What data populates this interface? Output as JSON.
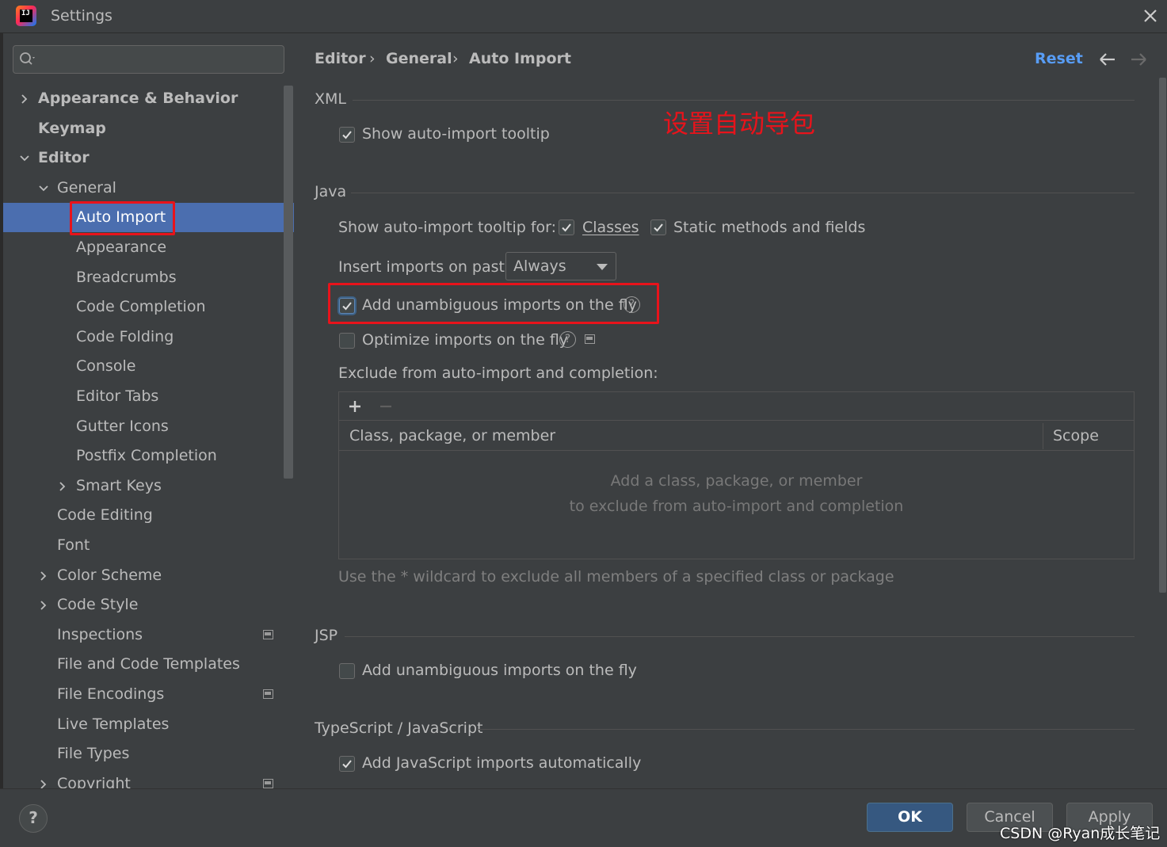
{
  "window": {
    "title": "Settings"
  },
  "sidebar": {
    "search_placeholder": "",
    "items": [
      {
        "label": "Appearance & Behavior",
        "bold": true,
        "chevron": "right"
      },
      {
        "label": "Keymap",
        "bold": true
      },
      {
        "label": "Editor",
        "bold": true,
        "chevron": "down"
      },
      {
        "label": "General",
        "chevron": "down"
      },
      {
        "label": "Auto Import",
        "selected": true
      },
      {
        "label": "Appearance"
      },
      {
        "label": "Breadcrumbs"
      },
      {
        "label": "Code Completion"
      },
      {
        "label": "Code Folding"
      },
      {
        "label": "Console"
      },
      {
        "label": "Editor Tabs"
      },
      {
        "label": "Gutter Icons"
      },
      {
        "label": "Postfix Completion"
      },
      {
        "label": "Smart Keys",
        "chevron": "right"
      },
      {
        "label": "Code Editing"
      },
      {
        "label": "Font"
      },
      {
        "label": "Color Scheme",
        "chevron": "right"
      },
      {
        "label": "Code Style",
        "chevron": "right"
      },
      {
        "label": "Inspections",
        "badge": true
      },
      {
        "label": "File and Code Templates"
      },
      {
        "label": "File Encodings",
        "badge": true
      },
      {
        "label": "Live Templates"
      },
      {
        "label": "File Types"
      },
      {
        "label": "Copyright",
        "chevron": "right",
        "badge": true
      }
    ]
  },
  "breadcrumb": {
    "part1": "Editor",
    "sep": "›",
    "part2": "General",
    "part3": "Auto Import"
  },
  "header": {
    "reset_label": "Reset"
  },
  "annotation": {
    "text": "设置自动导包"
  },
  "xml": {
    "title": "XML",
    "show_tooltip_label": "Show auto-import tooltip",
    "show_tooltip_checked": true
  },
  "java": {
    "title": "Java",
    "tooltip_for_label": "Show auto-import tooltip for:",
    "classes_label": "Classes",
    "classes_checked": true,
    "static_label": "Static methods and fields",
    "static_checked": true,
    "insert_on_paste_label": "Insert imports on paste:",
    "insert_on_paste_value": "Always",
    "add_unambiguous_label": "Add unambiguous imports on the fly",
    "add_unambiguous_checked": true,
    "optimize_label": "Optimize imports on the fly",
    "optimize_checked": false,
    "exclude_label": "Exclude from auto-import and completion:",
    "table": {
      "col1": "Class, package, or member",
      "col2": "Scope",
      "empty_line1": "Add a class, package, or member",
      "empty_line2": "to exclude from auto-import and completion"
    },
    "hint": "Use the * wildcard to exclude all members of a specified class or package"
  },
  "jsp": {
    "title": "JSP",
    "add_unambiguous_label": "Add unambiguous imports on the fly",
    "add_unambiguous_checked": false
  },
  "typescript": {
    "title": "TypeScript / JavaScript",
    "add_js_label": "Add JavaScript imports automatically",
    "add_js_checked": true
  },
  "buttons": {
    "help": "?",
    "ok": "OK",
    "cancel": "Cancel",
    "apply": "Apply"
  },
  "watermark": "CSDN @Ryan成长笔记",
  "colors": {
    "accent": "#4b6eaf",
    "link": "#589df6",
    "annotation": "#e8131b",
    "ok_button": "#365880"
  }
}
